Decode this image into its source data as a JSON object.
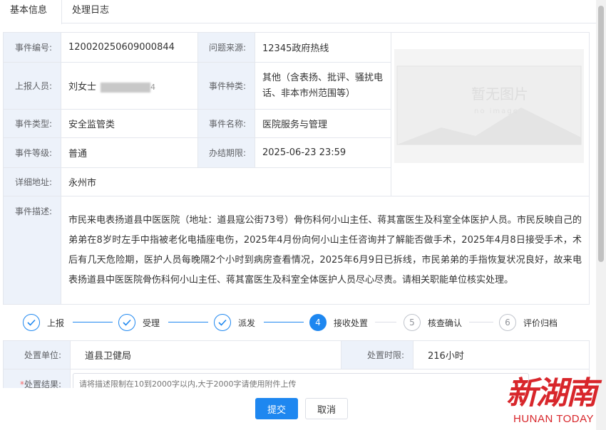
{
  "tabs": [
    {
      "label": "基本信息",
      "active": true
    },
    {
      "label": "处理日志",
      "active": false
    }
  ],
  "info": {
    "event_no_label": "事件编号:",
    "event_no": "120020250609000844",
    "source_label": "问题来源:",
    "source": "12345政府热线",
    "reporter_label": "上报人员:",
    "reporter_name": "刘女士",
    "reporter_mask_tail": "4",
    "category_label": "事件种类:",
    "category": "其他（含表扬、批评、骚扰电话、非本市州范围等）",
    "type_label": "事件类型:",
    "type": "安全监管类",
    "name_label": "事件名称:",
    "name": "医院服务与管理",
    "level_label": "事件等级:",
    "level": "普通",
    "deadline_label": "办结期限:",
    "deadline": "2025-06-23 23:59",
    "address_label": "详细地址:",
    "address": "永州市",
    "desc_label": "事件描述:",
    "desc": "市民来电表扬道县中医医院（地址：道县寇公街73号）骨伤科何小山主任、蒋其富医生及科室全体医护人员。市民反映自己的弟弟在8岁时左手中指被老化电插座电伤，2025年4月份向何小山主任咨询并了解能否做手术，2025年4月8日接受手术，术后有几天危险期，医护人员每晚隔2个小时到病房查看情况，2025年6月9日已拆线，市民弟弟的手指恢复状况良好，故来电表扬道县中医医院骨伤科何小山主任、蒋其富医生及科室全体医护人员尽心尽责。请相关职能单位核实处理。",
    "image_placeholder": "暂无图片",
    "image_placeholder_sub": "no image"
  },
  "steps": [
    {
      "label": "上报",
      "status": "done",
      "num": "1"
    },
    {
      "label": "受理",
      "status": "done",
      "num": "2"
    },
    {
      "label": "派发",
      "status": "done",
      "num": "3"
    },
    {
      "label": "接收处置",
      "status": "active",
      "num": "4"
    },
    {
      "label": "核查确认",
      "status": "wait",
      "num": "5"
    },
    {
      "label": "评价归档",
      "status": "wait",
      "num": "6"
    }
  ],
  "handling": {
    "unit_label": "处置单位:",
    "unit": "道县卫健局",
    "limit_label": "处置时限:",
    "limit": "216小时",
    "result_required_mark": "*",
    "result_label": "处置结果:",
    "result_placeholder": "请将描述限制在10到2000字以内,大于2000字请使用附件上传"
  },
  "buttons": {
    "submit": "提交",
    "cancel": "取消"
  },
  "watermark": {
    "cn": "新湖南",
    "en": "HUNAN TODAY"
  },
  "colors": {
    "primary": "#1e87f0",
    "label_bg": "#edf2fa",
    "watermark": "#d8262b"
  }
}
